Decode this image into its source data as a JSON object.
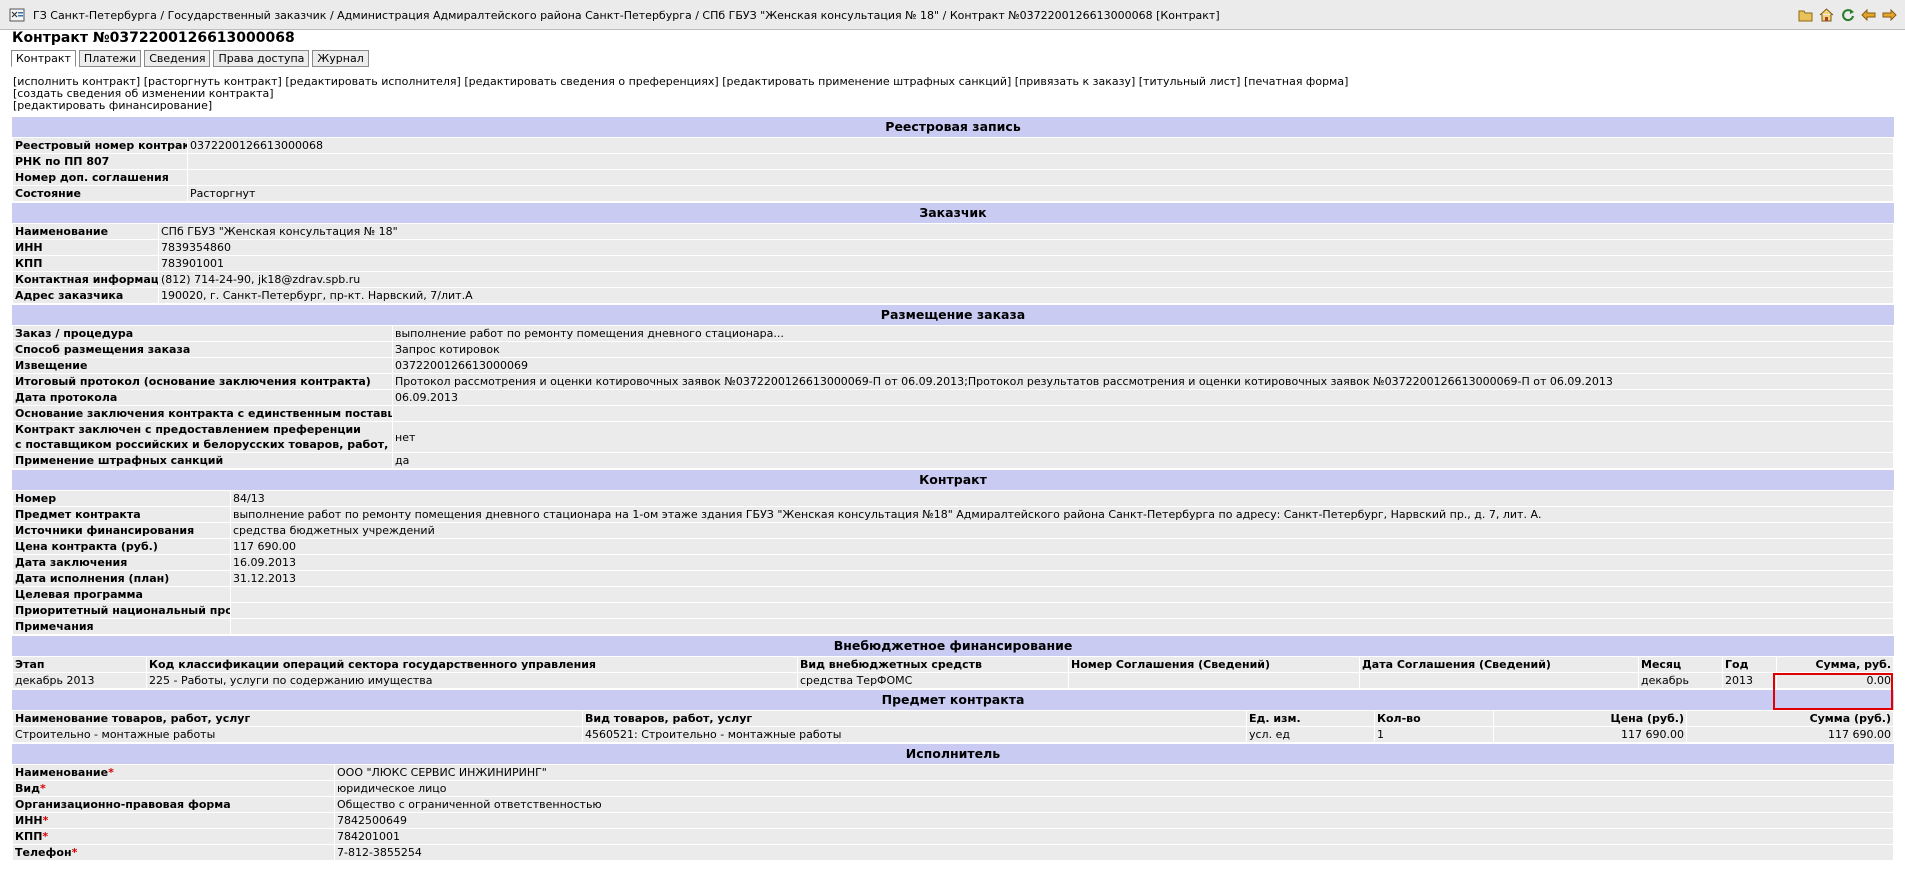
{
  "breadcrumb": "ГЗ Санкт-Петербурга / Государственный заказчик / Администрация Адмиралтейского района Санкт-Петербурга / СПб ГБУЗ \"Женская консультация № 18\" / Контракт №0372200126613000068 [Контракт]",
  "page_title": "Контракт №0372200126613000068",
  "toolbar_icons": [
    "folder-icon",
    "home-icon",
    "refresh-icon",
    "back-icon",
    "forward-icon"
  ],
  "tabs": [
    {
      "label": "Контракт",
      "active": true
    },
    {
      "label": "Платежи"
    },
    {
      "label": "Сведения"
    },
    {
      "label": "Права доступа"
    },
    {
      "label": "Журнал"
    }
  ],
  "actions": {
    "row1": [
      "[исполнить контракт]",
      "[расторгнуть контракт]",
      "[редактировать исполнителя]",
      "[редактировать сведения о преференциях]",
      "[редактировать применение штрафных санкций]",
      "[привязать к заказу]",
      "[титульный лист]",
      "[печатная форма]"
    ],
    "row2": [
      "[создать сведения об изменении контракта]"
    ],
    "row3": [
      "[редактировать финансирование]"
    ]
  },
  "registry": {
    "title": "Реестровая запись",
    "rows": [
      {
        "label": "Реестровый номер контракта",
        "value": "0372200126613000068"
      },
      {
        "label": "РНК по ПП 807",
        "value": ""
      },
      {
        "label": "Номер доп. соглашения",
        "value": ""
      },
      {
        "label": "Состояние",
        "value": "Расторгнут"
      }
    ]
  },
  "customer": {
    "title": "Заказчик",
    "rows": [
      {
        "label": "Наименование",
        "value": "СПб ГБУЗ \"Женская консультация № 18\""
      },
      {
        "label": "ИНН",
        "value": "7839354860"
      },
      {
        "label": "КПП",
        "value": "783901001"
      },
      {
        "label": "Контактная информация",
        "value": "(812) 714-24-90, jk18@zdrav.spb.ru"
      },
      {
        "label": "Адрес заказчика",
        "value": "190020, г. Санкт-Петербург, пр-кт. Нарвский, 7/лит.А"
      }
    ]
  },
  "placement": {
    "title": "Размещение заказа",
    "rows": [
      {
        "label": "Заказ / процедура",
        "value": "выполнение работ по ремонту помещения дневного стационара..."
      },
      {
        "label": "Способ размещения заказа",
        "value": "Запрос котировок"
      },
      {
        "label": "Извещение",
        "value": "0372200126613000069"
      },
      {
        "label": "Итоговый протокол (основание заключения контракта)",
        "value": "Протокол рассмотрения и оценки котировочных заявок №0372200126613000069-П от 06.09.2013;Протокол результатов рассмотрения и оценки котировочных заявок №0372200126613000069-П от 06.09.2013"
      },
      {
        "label": "Дата протокола",
        "value": "06.09.2013"
      },
      {
        "label": "Основание заключения контракта с единственным поставщиком",
        "value": ""
      }
    ],
    "preference_label_1": "Контракт заключен с предоставлением преференции",
    "preference_label_2": "с поставщиком российских и белорусских товаров, работ, услуг",
    "preference_value": "нет",
    "penalty_label": "Применение штрафных санкций",
    "penalty_value": "да"
  },
  "contract": {
    "title": "Контракт",
    "rows": [
      {
        "label": "Номер",
        "value": "84/13"
      },
      {
        "label": "Предмет контракта",
        "value": "выполнение работ по ремонту помещения дневного стационара на 1-ом этаже здания ГБУЗ \"Женская консультация №18\" Адмиралтейского района Санкт-Петербурга по адресу: Санкт-Петербург, Нарвский пр., д. 7, лит. А."
      },
      {
        "label": "Источники финансирования",
        "value": "средства бюджетных учреждений"
      },
      {
        "label": "Цена контракта (руб.)",
        "value": "117 690.00"
      },
      {
        "label": "Дата заключения",
        "value": "16.09.2013"
      },
      {
        "label": "Дата исполнения (план)",
        "value": "31.12.2013"
      },
      {
        "label": "Целевая программа",
        "value": ""
      },
      {
        "label": "Приоритетный национальный проект",
        "value": ""
      },
      {
        "label": "Примечания",
        "value": ""
      }
    ]
  },
  "offbudget": {
    "title": "Внебюджетное финансирование",
    "headers": [
      "Этап",
      "Код классификации операций сектора государственного управления",
      "Вид внебюджетных средств",
      "Номер Соглашения (Сведений)",
      "Дата Соглашения (Сведений)",
      "Месяц",
      "Год",
      "Сумма, руб."
    ],
    "row": [
      "декабрь 2013",
      "225 - Работы, услуги по содержанию имущества",
      "средства ТерФОМС",
      "",
      "",
      "декабрь",
      "2013",
      "0.00"
    ]
  },
  "subject": {
    "title": "Предмет контракта",
    "headers": [
      "Наименование товаров, работ, услуг",
      "Вид товаров, работ, услуг",
      "Ед. изм.",
      "Кол-во",
      "Цена (руб.)",
      "Сумма (руб.)"
    ],
    "row": [
      "Строительно - монтажные работы",
      "4560521: Строительно - монтажные работы",
      "усл. ед",
      "1",
      "117 690.00",
      "117 690.00"
    ]
  },
  "executor": {
    "title": "Исполнитель",
    "rows": [
      {
        "label": "Наименование",
        "required": true,
        "value": "ООО \"ЛЮКС СЕРВИС ИНЖИНИРИНГ\""
      },
      {
        "label": "Вид",
        "required": true,
        "value": "юридическое лицо"
      },
      {
        "label": "Организационно-правовая форма",
        "required": false,
        "value": "Общество с ограниченной ответственностью"
      },
      {
        "label": "ИНН",
        "required": true,
        "value": "7842500649"
      },
      {
        "label": "КПП",
        "required": true,
        "value": "784201001"
      },
      {
        "label": "Телефон",
        "required": true,
        "value": "7-812-3855254"
      }
    ],
    "required_mark": "*"
  }
}
